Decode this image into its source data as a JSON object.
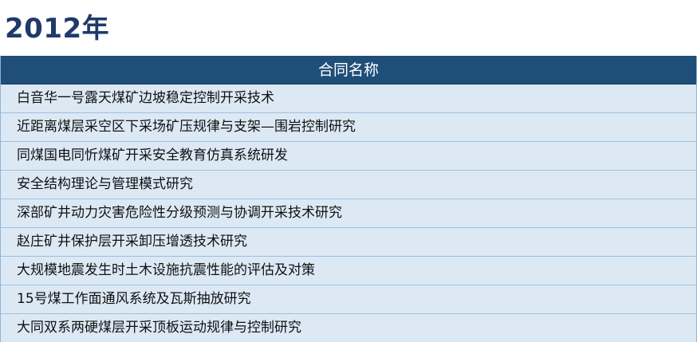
{
  "title": "2012年",
  "table": {
    "header": "合同名称",
    "rows": [
      "白音华一号露天煤矿边坡稳定控制开采技术",
      "近距离煤层采空区下采场矿压规律与支架—围岩控制研究",
      "同煤国电同忻煤矿开采安全教育仿真系统研发",
      "安全结构理论与管理模式研究",
      "深部矿井动力灾害危险性分级预测与协调开采技术研究",
      "赵庄矿井保护层开采卸压增透技术研究",
      "大规模地震发生时土木设施抗震性能的评估及对策",
      "15号煤工作面通风系统及瓦斯抽放研究",
      "大同双系两硬煤层开采顶板运动规律与控制研究"
    ]
  },
  "colors": {
    "title": "#1f3a6b",
    "header_bg": "#1f4e79",
    "row_bg": "#dce9f5",
    "row_border": "#9cc0e0"
  }
}
